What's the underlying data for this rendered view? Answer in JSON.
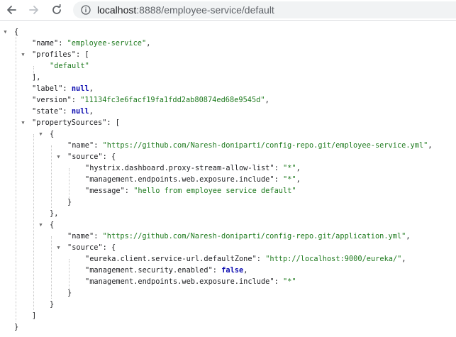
{
  "browser": {
    "url_host": "localhost",
    "url_path": ":8888/employee-service/default"
  },
  "json": {
    "name_key": "\"name\"",
    "name_val": "\"employee-service\"",
    "profiles_key": "\"profiles\"",
    "profiles_0": "\"default\"",
    "label_key": "\"label\"",
    "label_val": "null",
    "version_key": "\"version\"",
    "version_val": "\"11134fc3e6facf19fa1fdd2ab80874ed68e9545d\"",
    "state_key": "\"state\"",
    "state_val": "null",
    "ps_key": "\"propertySources\"",
    "ps": [
      {
        "name_key": "\"name\"",
        "name_val": "\"https://github.com/Naresh-doniparti/config-repo.git/employee-service.yml\"",
        "source_key": "\"source\"",
        "entries": [
          {
            "k": "\"hystrix.dashboard.proxy-stream-allow-list\"",
            "v": "\"*\""
          },
          {
            "k": "\"management.endpoints.web.exposure.include\"",
            "v": "\"*\""
          },
          {
            "k": "\"message\"",
            "v": "\"hello from employee service default\""
          }
        ]
      },
      {
        "name_key": "\"name\"",
        "name_val": "\"https://github.com/Naresh-doniparti/config-repo.git/application.yml\"",
        "source_key": "\"source\"",
        "entries": [
          {
            "k": "\"eureka.client.service-url.defaultZone\"",
            "v": "\"http://localhost:9000/eureka/\""
          },
          {
            "k": "\"management.security.enabled\"",
            "v": "false"
          },
          {
            "k": "\"management.endpoints.web.exposure.include\"",
            "v": "\"*\""
          }
        ]
      }
    ]
  }
}
